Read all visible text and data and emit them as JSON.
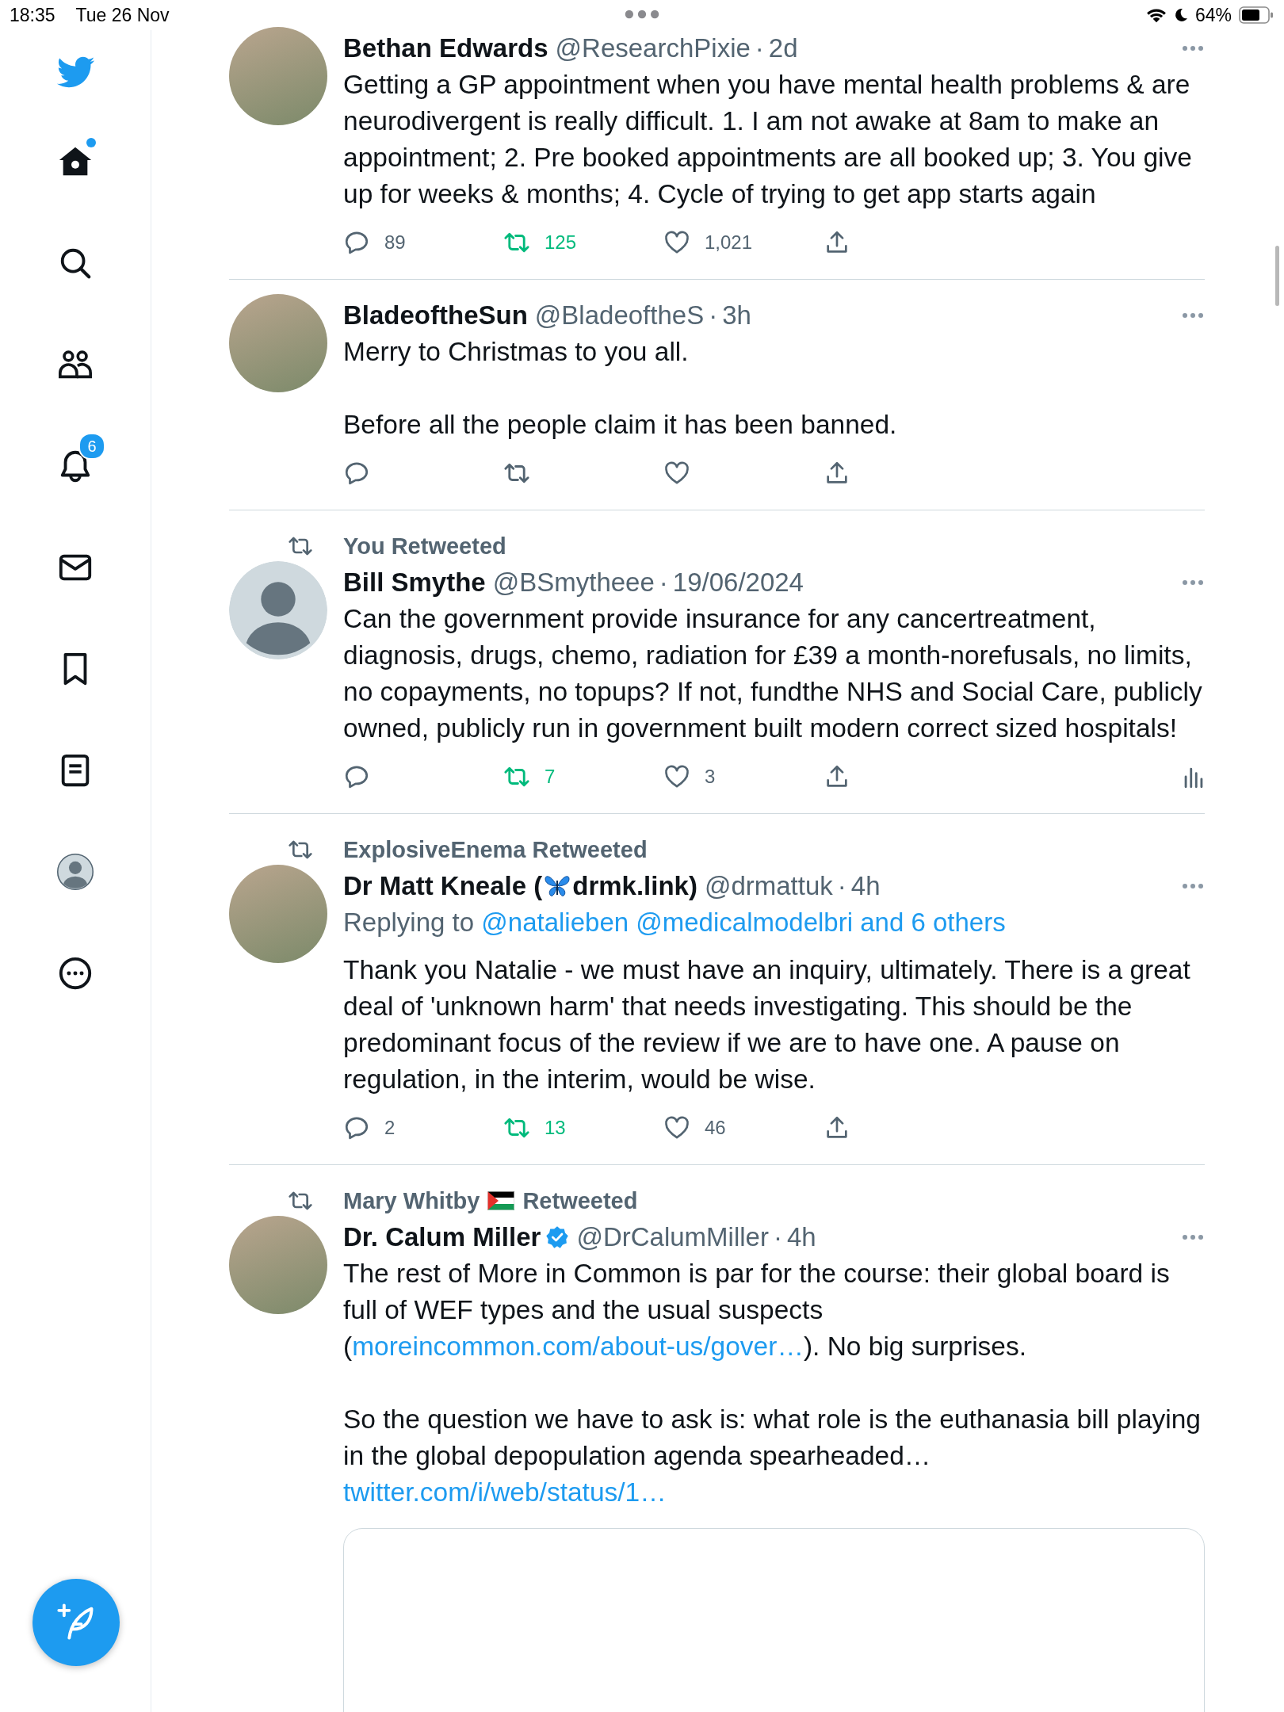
{
  "status_bar": {
    "time": "18:35",
    "date": "Tue 26 Nov",
    "battery": "64%"
  },
  "sidebar": {
    "items": [
      {
        "kind": "home",
        "dot": true
      },
      {
        "kind": "search"
      },
      {
        "kind": "communities"
      },
      {
        "kind": "notifications",
        "badge": "6"
      },
      {
        "kind": "messages"
      },
      {
        "kind": "bookmarks"
      },
      {
        "kind": "lists"
      },
      {
        "kind": "profile"
      },
      {
        "kind": "more"
      }
    ]
  },
  "tweets": [
    {
      "avatar": {
        "kind": "photo"
      },
      "name": [
        {
          "kind": "text",
          "text": "Bethan Edwards"
        }
      ],
      "handle": "@ResearchPixie",
      "separator": "·",
      "time": "2d",
      "body": [
        [
          {
            "kind": "text",
            "text": "Getting a GP appointment when you have mental health problems & are neurodivergent is really difficult.  1. I am not awake at 8am to make an appointment; 2. Pre booked appointments are all booked up; 3. You give up for weeks & months; 4. Cycle of trying to get app starts again"
          }
        ]
      ],
      "actions": {
        "replies": "89",
        "retweets": "125",
        "likes": "1,021",
        "retweeted": true,
        "liked": false
      }
    },
    {
      "avatar": {
        "kind": "photo"
      },
      "name": [
        {
          "kind": "text",
          "text": "BladeoftheSun"
        }
      ],
      "handle": "@BladeoftheS",
      "separator": "·",
      "time": "3h",
      "body": [
        [
          {
            "kind": "text",
            "text": "Merry to Christmas to you all."
          }
        ],
        [
          {
            "kind": "text",
            "text": "Before all the people claim it has been banned."
          }
        ]
      ],
      "actions": {
        "retweeted": false,
        "liked": false
      }
    },
    {
      "context": [
        {
          "kind": "text",
          "text": "You Retweeted"
        }
      ],
      "avatar": {
        "kind": "default"
      },
      "name": [
        {
          "kind": "text",
          "text": "Bill Smythe"
        }
      ],
      "handle": "@BSmytheee",
      "separator": "·",
      "time": "19/06/2024",
      "body": [
        [
          {
            "kind": "text",
            "text": "Can the government provide insurance for any cancertreatment, diagnosis, drugs, chemo, radiation for £39 a month-norefusals, no limits, no copayments,  no topups? If not, fundthe NHS and Social Care, publicly owned, publicly run in government built modern correct sized hospitals!"
          }
        ]
      ],
      "actions": {
        "retweets": "7",
        "likes": "3",
        "retweeted": true,
        "liked": false,
        "analytics": true
      }
    },
    {
      "context": [
        {
          "kind": "text",
          "text": "ExplosiveEnema Retweeted"
        }
      ],
      "avatar": {
        "kind": "photo"
      },
      "name": [
        {
          "kind": "text",
          "text": "Dr Matt Kneale ("
        },
        {
          "kind": "butterfly"
        },
        {
          "kind": "text",
          "text": "drmk.link)"
        }
      ],
      "handle": "@drmattuk",
      "separator": "·",
      "time": "4h",
      "replying": {
        "label": "Replying to",
        "links": [
          "@natalieben",
          "@medicalmodelbri",
          "and 6 others"
        ]
      },
      "body": [
        [
          {
            "kind": "text",
            "text": "Thank you Natalie - we must have an inquiry, ultimately. There is a great deal of 'unknown harm' that needs investigating. This should be the predominant focus of the review if we are to have one. A pause on regulation, in the interim, would be wise."
          }
        ]
      ],
      "actions": {
        "replies": "2",
        "retweets": "13",
        "likes": "46",
        "retweeted": true,
        "liked": false
      }
    },
    {
      "context": [
        {
          "kind": "text",
          "text": "Mary Whitby"
        },
        {
          "kind": "flag"
        },
        {
          "kind": "text",
          "text": "Retweeted"
        }
      ],
      "avatar": {
        "kind": "photo"
      },
      "name": [
        {
          "kind": "text",
          "text": "Dr. Calum Miller"
        }
      ],
      "verified": true,
      "handle": "@DrCalumMiller",
      "separator": "·",
      "time": "4h",
      "body": [
        [
          {
            "kind": "text",
            "text": "The rest of More in Common is par for the course: their global board is full of WEF types and the usual suspects ("
          },
          {
            "kind": "link",
            "text": "moreincommon.com/about-us/gover…"
          },
          {
            "kind": "text",
            "text": "). No big surprises."
          }
        ],
        [
          {
            "kind": "text",
            "text": "So the question we have to ask is: what role is the euthanasia bill playing in the global depopulation agenda spearheaded… "
          },
          {
            "kind": "link",
            "text": "twitter.com/i/web/status/1…"
          }
        ]
      ],
      "link_card": true
    }
  ]
}
